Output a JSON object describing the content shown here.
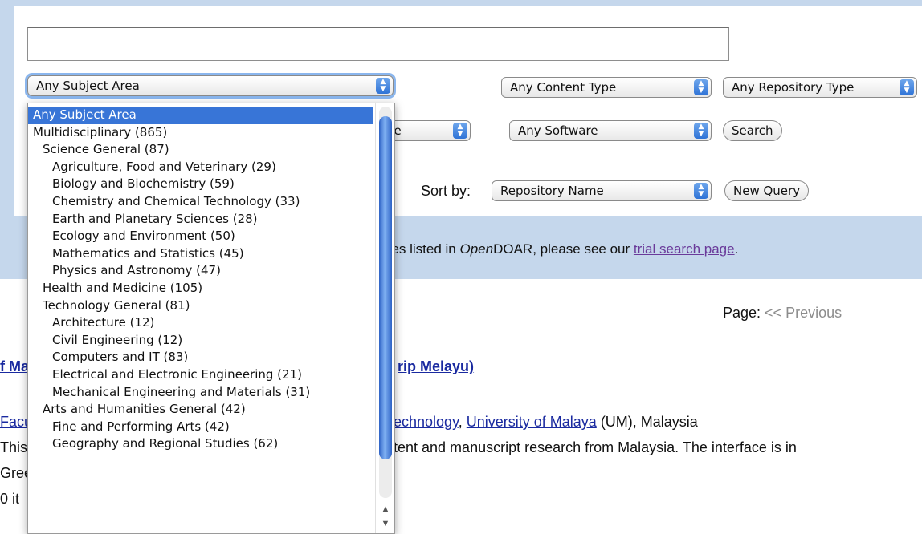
{
  "search": {
    "query_value": ""
  },
  "filters": {
    "subject_area": "Any Subject Area",
    "content_type": "Any Content Type",
    "repository_type": "Any Repository Type",
    "language_partial": "ge",
    "software": "Any Software",
    "search_button": "Search",
    "sort_label": "Sort by:",
    "sort_value": "Repository Name",
    "new_query_button": "New Query"
  },
  "info": {
    "text_partial": "ries listed in ",
    "text_italic_open": "Open",
    "text_after_italic": "DOAR, please see our ",
    "link": "trial search page",
    "text_end": "."
  },
  "pagination": {
    "label": "Page: ",
    "previous": "<< Previous"
  },
  "result": {
    "title_left": "f Ma",
    "title_right": "rip Melayu)",
    "org_left": "Facu",
    "org_link1": "echnology",
    "org_sep": ", ",
    "org_link2": "University of Malaya",
    "org_tail": " (UM), Malaysia",
    "desc_left": "This",
    "desc_right": "tent and manuscript research from Malaysia. The interface is in",
    "green_left": "Gree",
    "items_left": "0 it"
  },
  "dropdown": {
    "items": [
      {
        "label": "Any Subject Area",
        "level": 0,
        "selected": true
      },
      {
        "label": "Multidisciplinary (865)",
        "level": 0
      },
      {
        "label": "Science General (87)",
        "level": 1
      },
      {
        "label": "Agriculture, Food and Veterinary (29)",
        "level": 2
      },
      {
        "label": "Biology and Biochemistry (59)",
        "level": 2
      },
      {
        "label": "Chemistry and Chemical Technology (33)",
        "level": 2
      },
      {
        "label": "Earth and Planetary Sciences (28)",
        "level": 2
      },
      {
        "label": "Ecology and Environment (50)",
        "level": 2
      },
      {
        "label": "Mathematics and Statistics (45)",
        "level": 2
      },
      {
        "label": "Physics and Astronomy (47)",
        "level": 2
      },
      {
        "label": "Health and Medicine (105)",
        "level": 1
      },
      {
        "label": "Technology General (81)",
        "level": 1
      },
      {
        "label": "Architecture (12)",
        "level": 2
      },
      {
        "label": "Civil Engineering (12)",
        "level": 2
      },
      {
        "label": "Computers and IT (83)",
        "level": 2
      },
      {
        "label": "Electrical and Electronic Engineering (21)",
        "level": 2
      },
      {
        "label": "Mechanical Engineering and Materials (31)",
        "level": 2
      },
      {
        "label": "Arts and Humanities General (42)",
        "level": 1
      },
      {
        "label": "Fine and Performing Arts (42)",
        "level": 2
      },
      {
        "label": "Geography and Regional Studies (62)",
        "level": 2
      }
    ]
  },
  "icons": {
    "select_arrows": "up-down-arrows-icon",
    "scroll_up": "scroll-up-arrow-icon",
    "scroll_down": "scroll-down-arrow-icon"
  },
  "colors": {
    "selection": "#3875d7",
    "panel": "#c5d7ec",
    "link": "#1a2aa0",
    "visited_link": "#6a3a9a"
  }
}
